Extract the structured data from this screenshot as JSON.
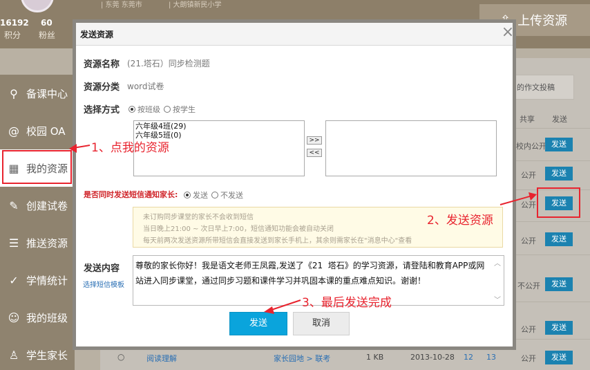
{
  "profile": {
    "location_a": "| 东莞 东莞市",
    "location_b": "| 大朗镇新民小学",
    "points_value": "16192",
    "points_label": "积分",
    "fans_value": "60",
    "fans_label": "粉丝"
  },
  "upload_button": "上传资源",
  "sidebar": {
    "items": [
      {
        "label": "备课中心"
      },
      {
        "label": "校园 OA"
      },
      {
        "label": "我的资源"
      },
      {
        "label": "创建试卷"
      },
      {
        "label": "推送资源"
      },
      {
        "label": "学情统计"
      },
      {
        "label": "我的班级"
      },
      {
        "label": "学生家长"
      }
    ]
  },
  "list": {
    "submit_label": "的作文投稿",
    "col_share": "共享",
    "col_send": "发送",
    "rows": [
      {
        "status": "校内公开",
        "send": "发送"
      },
      {
        "status": "公开",
        "send": "发送"
      },
      {
        "status": "公开",
        "send": "发送"
      },
      {
        "status": "公开",
        "send": "发送"
      },
      {
        "status": "不公开",
        "send": "发送"
      },
      {
        "status": "公开",
        "send": "发送"
      },
      {
        "status": "公开",
        "send": "发送"
      }
    ],
    "last_row": {
      "name": "阅读理解",
      "category": "家长园地 > 联考",
      "size": "1 KB",
      "date": "2013-10-28",
      "n1": "12",
      "n2": "13",
      "status": "公开",
      "send": "发送"
    }
  },
  "dialog": {
    "title": "发送资源",
    "close": "×",
    "name_label": "资源名称",
    "name_value": "(21.塔石）同步检测题",
    "category_label": "资源分类",
    "category_value": "word试卷",
    "method_label": "选择方式",
    "method_options": [
      "按班级",
      "按学生"
    ],
    "classes": [
      "六年级4班(29)",
      "六年级5班(0)"
    ],
    "move_right": ">>",
    "move_left": "<<",
    "sms_label": "是否同时发送短信通知家长:",
    "sms_options": [
      "发送",
      "不发送"
    ],
    "notice": [
      "未订购同步课堂的家长不会收到短信",
      "当日晚上21:00 ~ 次日早上7:00，短信通知功能会被自动关闭",
      "每天前两次发送资源所带短信会直接发送到家长手机上，其余则需家长在\"消息中心\"查看"
    ],
    "content_label": "发送内容",
    "template_link": "选择短信模板",
    "message": "尊敬的家长你好！我是语文老师王凤霞,发送了《21  塔石》的学习资源，请登陆和教育APP或网站进入同步课堂，通过同步习题和课件学习并巩固本课的重点难点知识。谢谢！",
    "send_button": "发送",
    "cancel_button": "取消"
  },
  "annotations": {
    "step1": "1、点我的资源",
    "step2": "2、发送资源",
    "step3": "3、最后发送完成",
    "color": "#e8232e"
  }
}
